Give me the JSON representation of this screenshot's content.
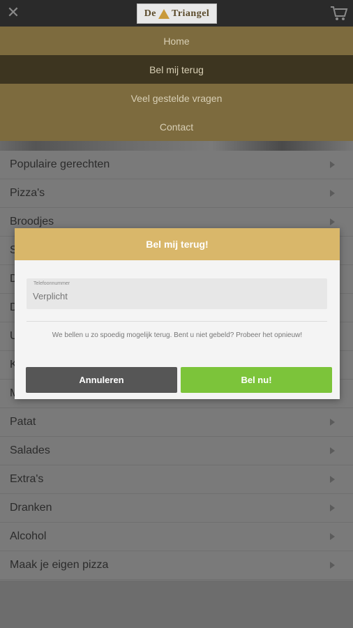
{
  "header": {
    "logo_text_left": "De",
    "logo_text_right": "Triangel"
  },
  "nav": {
    "items": [
      {
        "label": "Home",
        "active": false
      },
      {
        "label": "Bel mij terug",
        "active": true
      },
      {
        "label": "Veel gestelde vragen",
        "active": false
      },
      {
        "label": "Contact",
        "active": false
      }
    ]
  },
  "menu": {
    "items": [
      "Populaire gerechten",
      "Pizza's",
      "Broodjes",
      "S",
      "D",
      "D",
      "U",
      "K",
      "M",
      "Patat",
      "Salades",
      "Extra's",
      "Dranken",
      "Alcohol",
      "Maak je eigen pizza"
    ]
  },
  "modal": {
    "title": "Bel mij terug!",
    "phone_label": "Telefoonnummer",
    "phone_placeholder": "Verplicht",
    "message": "We bellen u zo spoedig mogelijk terug. Bent u niet gebeld? Probeer het opnieuw!",
    "cancel_label": "Annuleren",
    "call_label": "Bel nu!"
  },
  "colors": {
    "nav_bg": "#7d6b3e",
    "nav_active": "#3d3520",
    "modal_header": "#d9b76a",
    "call_button": "#7cc43a",
    "cancel_button": "#565656"
  }
}
